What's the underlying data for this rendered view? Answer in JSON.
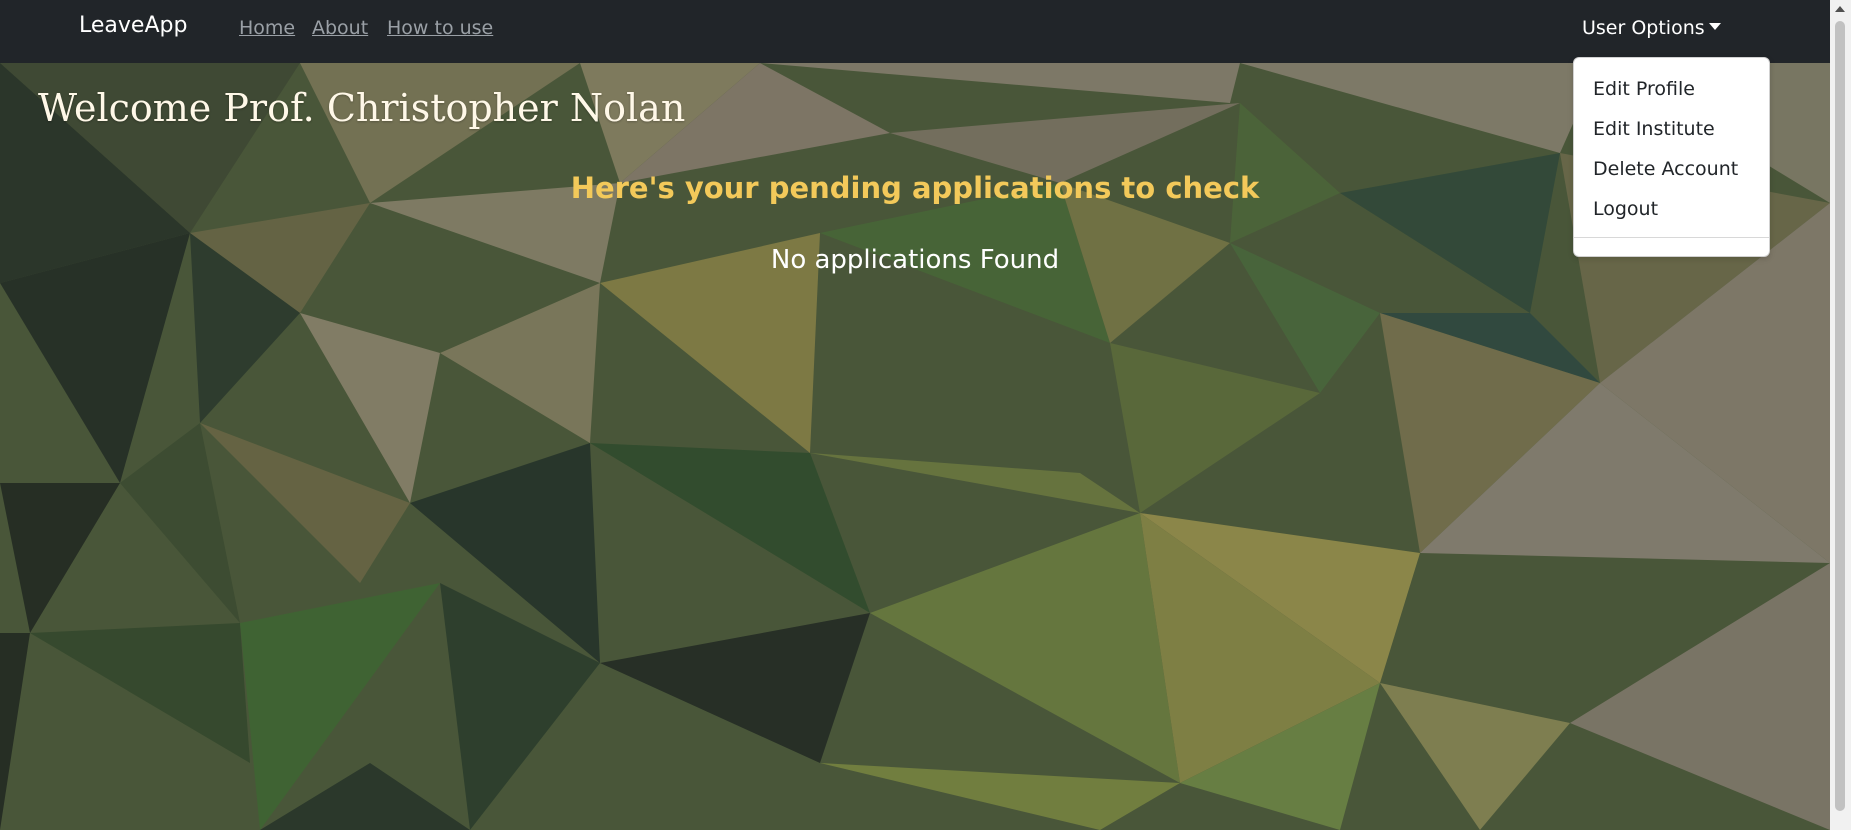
{
  "nav": {
    "brand": "LeaveApp",
    "links": [
      "Home",
      "About",
      "How to use"
    ],
    "user_menu_label": "User Options"
  },
  "user_menu": {
    "items": [
      "Edit Profile",
      "Edit Institute",
      "Delete Account",
      "Logout"
    ]
  },
  "main": {
    "welcome": "Welcome Prof. Christopher Nolan",
    "subtitle": "Here's your pending applications to check",
    "empty_message": "No applications Found"
  },
  "colors": {
    "navbar": "#212529",
    "subtitle": "#f3c95a",
    "welcome": "#fff8e8"
  },
  "icons": [
    "caret-down-icon",
    "scroll-up-arrow-icon"
  ]
}
